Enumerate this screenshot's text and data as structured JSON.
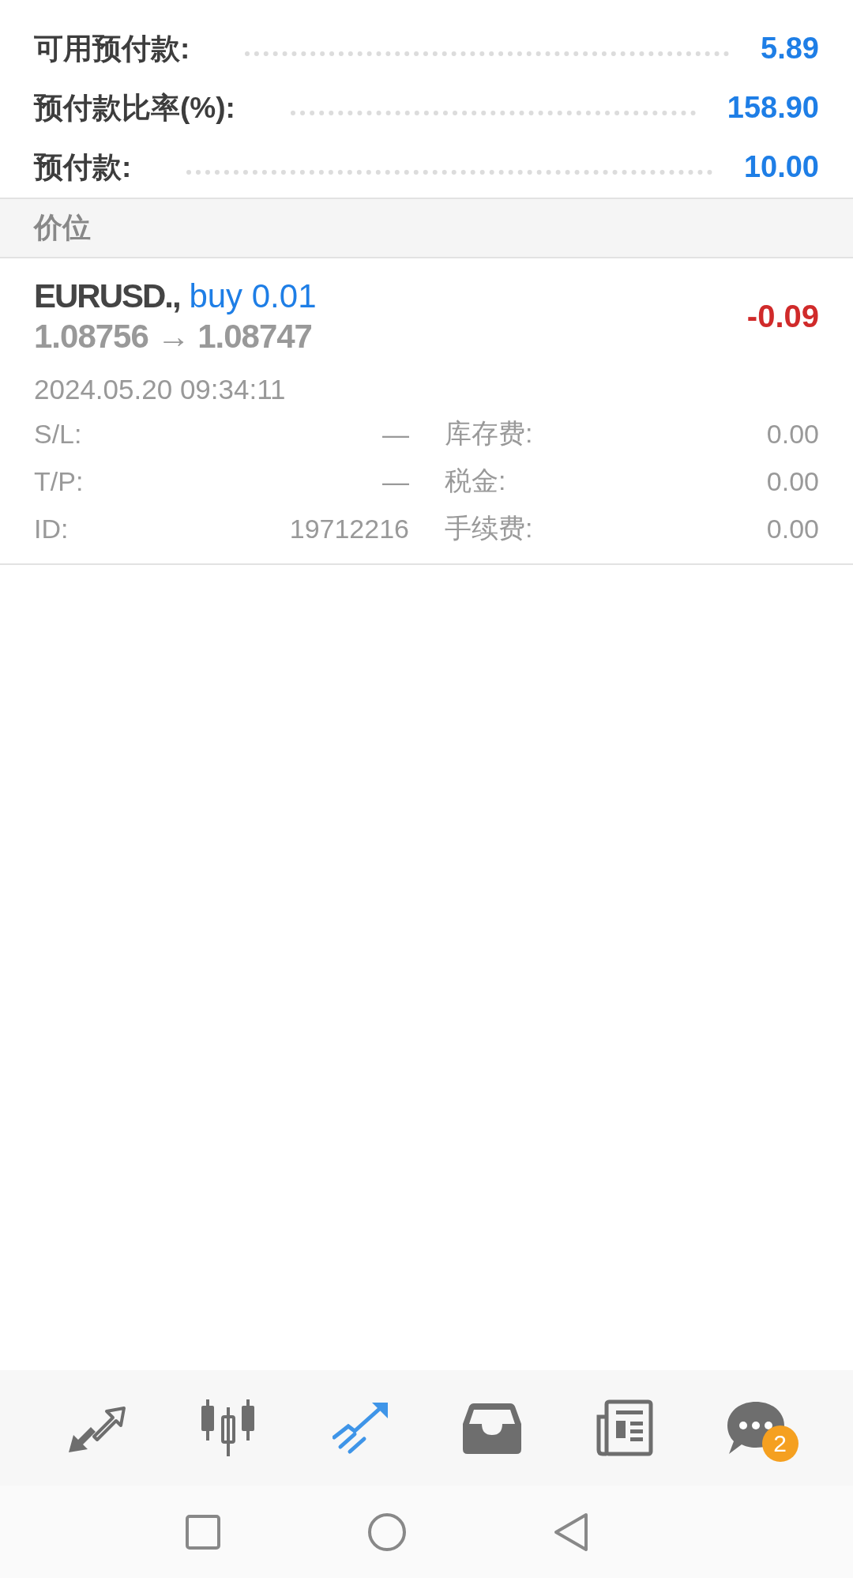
{
  "summary": [
    {
      "label": "可用预付款:",
      "value": "5.89"
    },
    {
      "label": "预付款比率(%):",
      "value": "158.90"
    },
    {
      "label": "预付款:",
      "value": "10.00"
    }
  ],
  "section": {
    "title": "价位"
  },
  "positions": [
    {
      "symbol": "EURUSD.,",
      "side": "buy 0.01",
      "prices": "1.08756 → 1.08747",
      "profit": "-0.09",
      "time": "2024.05.20 09:34:11",
      "details": [
        {
          "label": "S/L:",
          "value": "—",
          "label2": "库存费:",
          "value2": "0.00"
        },
        {
          "label": "T/P:",
          "value": "—",
          "label2": "税金:",
          "value2": "0.00"
        },
        {
          "label": "ID:",
          "value": "19712216",
          "label2": "手续费:",
          "value2": "0.00"
        }
      ]
    }
  ],
  "nav_items": [
    {
      "kind": "trade",
      "selected": false
    },
    {
      "kind": "chart",
      "selected": false
    },
    {
      "kind": "history",
      "selected": true
    },
    {
      "kind": "inbox",
      "selected": false
    },
    {
      "kind": "news",
      "selected": false
    },
    {
      "kind": "chat",
      "selected": false,
      "badge": "2"
    }
  ]
}
